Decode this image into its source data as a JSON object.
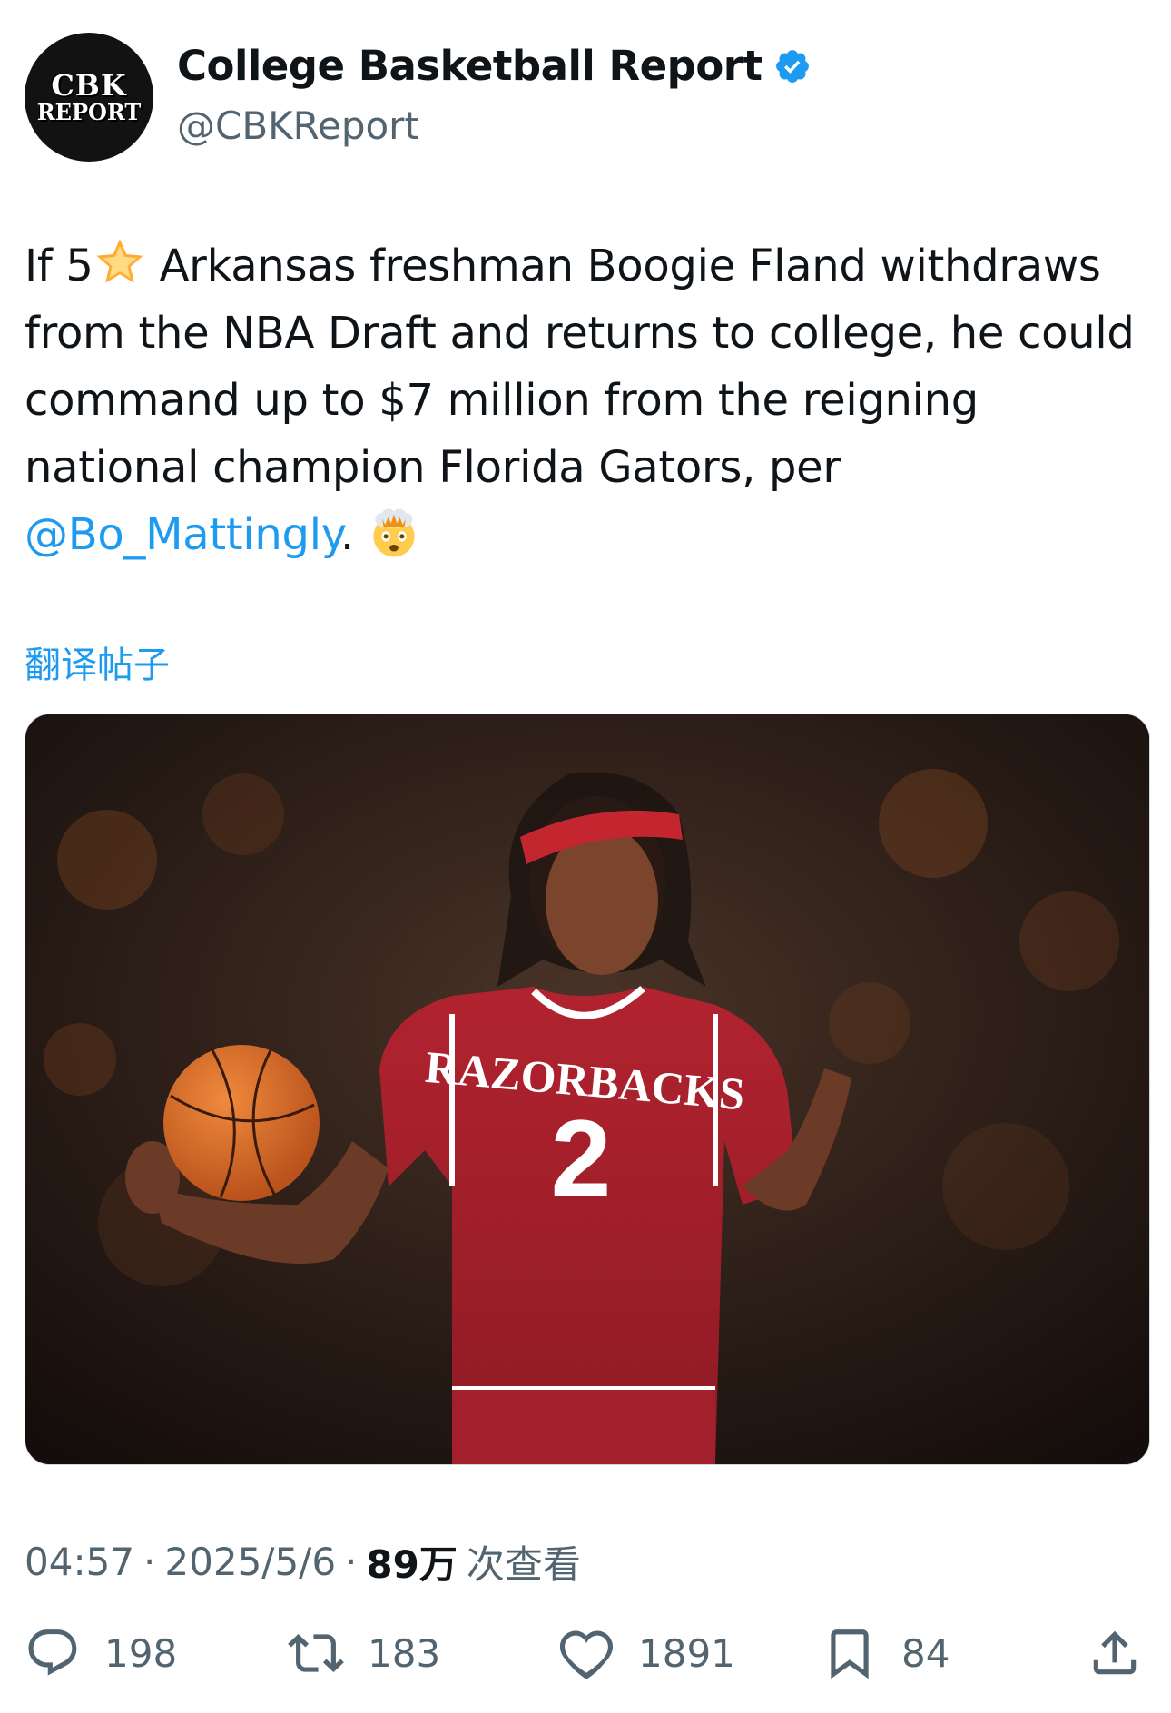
{
  "account": {
    "avatar_line1": "CBK",
    "avatar_line2": "REPORT",
    "display_name": "College Basketball Report",
    "handle": "@CBKReport"
  },
  "tweet": {
    "line1_pre": "If 5",
    "line1_post": " Arkansas freshman Boogie Fland withdraws",
    "line2": "from the NBA Draft and returns to college, he could",
    "line3": "command up to $7 million from the reigning",
    "line4": "national champion Florida Gators, per",
    "mention": "@Bo_Mattingly",
    "line5_post": ". ",
    "emoji_star": "star-emoji",
    "emoji_end": "exploding-head-emoji"
  },
  "translate_label": "翻译帖子",
  "media": {
    "jersey_team": "RAZORBACKS",
    "jersey_number": "2"
  },
  "meta": {
    "time": "04:57",
    "date": "2025/5/6",
    "views_count": "89万",
    "views_label": "次查看"
  },
  "actions": {
    "replies": "198",
    "reposts": "183",
    "likes": "1891",
    "bookmarks": "84"
  },
  "colors": {
    "accent": "#1d9bf0",
    "text": "#0f1419",
    "secondary": "#536471",
    "jersey_red": "#b1232f"
  }
}
